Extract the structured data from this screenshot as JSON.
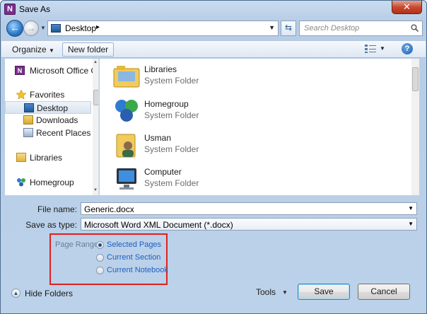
{
  "window": {
    "title": "Save As",
    "app_icon": "onenote-icon",
    "close_label": "✕"
  },
  "address": {
    "location": "Desktop",
    "search_placeholder": "Search Desktop"
  },
  "toolbar": {
    "organize_label": "Organize",
    "new_folder_label": "New folder"
  },
  "sidebar": {
    "items": [
      {
        "label": "Microsoft Office O",
        "icon": "onenote-icon"
      },
      {
        "label": "Favorites",
        "icon": "star-icon"
      },
      {
        "label": "Desktop",
        "icon": "desktop-icon",
        "selected": true
      },
      {
        "label": "Downloads",
        "icon": "downloads-icon"
      },
      {
        "label": "Recent Places",
        "icon": "recent-places-icon"
      },
      {
        "label": "Libraries",
        "icon": "libraries-icon"
      },
      {
        "label": "Homegroup",
        "icon": "homegroup-icon"
      }
    ]
  },
  "files": [
    {
      "name": "Libraries",
      "type": "System Folder",
      "icon": "libraries-folder-icon"
    },
    {
      "name": "Homegroup",
      "type": "System Folder",
      "icon": "homegroup-icon"
    },
    {
      "name": "Usman",
      "type": "System Folder",
      "icon": "user-folder-icon"
    },
    {
      "name": "Computer",
      "type": "System Folder",
      "icon": "computer-icon"
    }
  ],
  "form": {
    "file_name_label": "File name:",
    "file_name_value": "Generic.docx",
    "save_type_label": "Save as type:",
    "save_type_value": "Microsoft Word XML Document (*.docx)"
  },
  "page_range": {
    "label": "Page Range:",
    "options": [
      {
        "label": "Selected Pages",
        "selected": true
      },
      {
        "label": "Current Section",
        "selected": false
      },
      {
        "label": "Current Notebook",
        "selected": false
      }
    ],
    "highlight_color": "#e0201c"
  },
  "footer": {
    "hide_folders_label": "Hide Folders",
    "tools_label": "Tools",
    "save_label": "Save",
    "cancel_label": "Cancel"
  }
}
